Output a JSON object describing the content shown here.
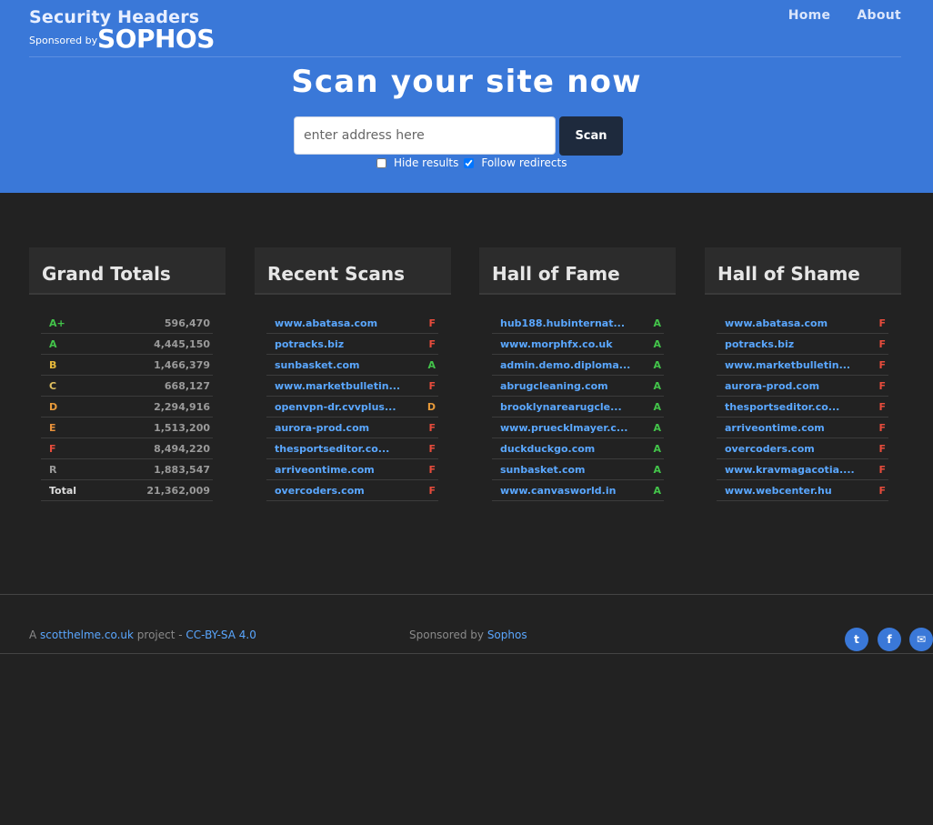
{
  "brand": {
    "title": "Security Headers",
    "sponsored_by": "Sponsored by",
    "sponsor_logo": "SOPHOS"
  },
  "nav": {
    "home": "Home",
    "about": "About"
  },
  "hero": {
    "title": "Scan your site now",
    "input_placeholder": "enter address here",
    "scan_label": "Scan",
    "hide_results_label": "Hide results",
    "hide_results_checked": false,
    "follow_redirects_label": "Follow redirects",
    "follow_redirects_checked": true
  },
  "grand_totals": {
    "title": "Grand Totals",
    "rows": [
      {
        "grade": "A+",
        "count": "596,470"
      },
      {
        "grade": "A",
        "count": "4,445,150"
      },
      {
        "grade": "B",
        "count": "1,466,379"
      },
      {
        "grade": "C",
        "count": "668,127"
      },
      {
        "grade": "D",
        "count": "2,294,916"
      },
      {
        "grade": "E",
        "count": "1,513,200"
      },
      {
        "grade": "F",
        "count": "8,494,220"
      },
      {
        "grade": "R",
        "count": "1,883,547"
      },
      {
        "grade": "Total",
        "count": "21,362,009"
      }
    ]
  },
  "recent_scans": {
    "title": "Recent Scans",
    "rows": [
      {
        "site": "www.abatasa.com",
        "grade": "F"
      },
      {
        "site": "potracks.biz",
        "grade": "F"
      },
      {
        "site": "sunbasket.com",
        "grade": "A"
      },
      {
        "site": "www.marketbulletin...",
        "grade": "F"
      },
      {
        "site": "openvpn-dr.cvvplus...",
        "grade": "D"
      },
      {
        "site": "aurora-prod.com",
        "grade": "F"
      },
      {
        "site": "thesportseditor.co...",
        "grade": "F"
      },
      {
        "site": "arriveontime.com",
        "grade": "F"
      },
      {
        "site": "overcoders.com",
        "grade": "F"
      }
    ]
  },
  "hall_of_fame": {
    "title": "Hall of Fame",
    "rows": [
      {
        "site": "hub188.hubinternat...",
        "grade": "A"
      },
      {
        "site": "www.morphfx.co.uk",
        "grade": "A"
      },
      {
        "site": "admin.demo.diploma...",
        "grade": "A"
      },
      {
        "site": "abrugcleaning.com",
        "grade": "A"
      },
      {
        "site": "brooklynarearugcle...",
        "grade": "A"
      },
      {
        "site": "www.pruecklmayer.c...",
        "grade": "A"
      },
      {
        "site": "duckduckgo.com",
        "grade": "A"
      },
      {
        "site": "sunbasket.com",
        "grade": "A"
      },
      {
        "site": "www.canvasworld.in",
        "grade": "A"
      }
    ]
  },
  "hall_of_shame": {
    "title": "Hall of Shame",
    "rows": [
      {
        "site": "www.abatasa.com",
        "grade": "F"
      },
      {
        "site": "potracks.biz",
        "grade": "F"
      },
      {
        "site": "www.marketbulletin...",
        "grade": "F"
      },
      {
        "site": "aurora-prod.com",
        "grade": "F"
      },
      {
        "site": "thesportseditor.co...",
        "grade": "F"
      },
      {
        "site": "arriveontime.com",
        "grade": "F"
      },
      {
        "site": "overcoders.com",
        "grade": "F"
      },
      {
        "site": "www.kravmagacotia....",
        "grade": "F"
      },
      {
        "site": "www.webcenter.hu",
        "grade": "F"
      }
    ]
  },
  "footer": {
    "prefix": "A",
    "author_link": "scotthelme.co.uk",
    "project_text": "project -",
    "license_link": "CC-BY-SA 4.0",
    "sponsored_text": "Sponsored by",
    "sponsor_link": "Sophos",
    "social": [
      {
        "icon": "twitter-icon",
        "glyph": "t"
      },
      {
        "icon": "facebook-icon",
        "glyph": "f"
      },
      {
        "icon": "email-icon",
        "glyph": "✉"
      }
    ]
  },
  "colors": {
    "hero_bg": "#3a78d8",
    "page_bg": "#222222",
    "link": "#5aa7ff",
    "grade_a": "#43c44a",
    "grade_f": "#e74c3c",
    "grade_d": "#e79a3a"
  }
}
